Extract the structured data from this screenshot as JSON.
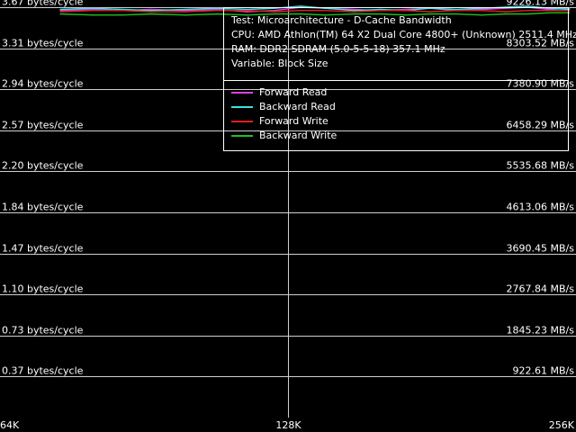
{
  "chart_data": {
    "type": "line",
    "title": "",
    "info": [
      "Test: Microarchitecture - D-Cache Bandwidth",
      "CPU: AMD Athlon(TM) 64 X2 Dual Core 4800+ (Unknown) 2511.4 MHz",
      "RAM: DDR2 SDRAM (5.0-5-5-18) 357.1 MHz",
      "Variable: Block Size"
    ],
    "y_left_ticks": [
      "3.67 bytes/cycle",
      "3.31 bytes/cycle",
      "2.94 bytes/cycle",
      "2.57 bytes/cycle",
      "2.20 bytes/cycle",
      "1.84 bytes/cycle",
      "1.47 bytes/cycle",
      "1.10 bytes/cycle",
      "0.73 bytes/cycle",
      "0.37 bytes/cycle"
    ],
    "y_right_ticks": [
      "9226.13 MB/s",
      "8303.52 MB/s",
      "7380.90 MB/s",
      "6458.29 MB/s",
      "5535.68 MB/s",
      "4613.06 MB/s",
      "3690.45 MB/s",
      "2767.84 MB/s",
      "1845.23 MB/s",
      "922.61 MB/s"
    ],
    "x_ticks": [
      "64K",
      "128K",
      "256K"
    ],
    "x_tick_values": [
      64,
      128,
      256
    ],
    "x_scale": "log2",
    "ylim": [
      0,
      3.67
    ],
    "xlim": [
      64,
      256
    ],
    "grid": true,
    "legend_position": "top-right",
    "x": [
      74,
      80,
      86,
      92,
      100,
      108,
      116,
      124,
      132,
      140,
      150,
      160,
      170,
      180,
      192,
      204,
      216,
      228,
      240,
      252
    ],
    "series": [
      {
        "name": "Forward Read",
        "color": "#e040e0",
        "values": [
          3.64,
          3.65,
          3.64,
          3.65,
          3.64,
          3.65,
          3.63,
          3.64,
          3.67,
          3.66,
          3.65,
          3.64,
          3.65,
          3.66,
          3.64,
          3.65,
          3.66,
          3.67,
          3.65,
          3.66
        ]
      },
      {
        "name": "Backward Read",
        "color": "#40e0e0",
        "values": [
          3.65,
          3.66,
          3.65,
          3.64,
          3.65,
          3.66,
          3.65,
          3.66,
          3.68,
          3.66,
          3.64,
          3.65,
          3.64,
          3.66,
          3.65,
          3.66,
          3.67,
          3.68,
          3.66,
          3.65
        ]
      },
      {
        "name": "Forward Write",
        "color": "#e02020",
        "values": [
          3.63,
          3.64,
          3.64,
          3.63,
          3.63,
          3.64,
          3.64,
          3.63,
          3.64,
          3.64,
          3.63,
          3.64,
          3.64,
          3.63,
          3.64,
          3.64,
          3.63,
          3.64,
          3.64,
          3.64
        ]
      },
      {
        "name": "Backward Write",
        "color": "#20c020",
        "values": [
          3.61,
          3.6,
          3.6,
          3.61,
          3.6,
          3.61,
          3.6,
          3.61,
          3.61,
          3.6,
          3.61,
          3.61,
          3.6,
          3.61,
          3.61,
          3.6,
          3.61,
          3.61,
          3.62,
          3.62
        ]
      }
    ]
  }
}
